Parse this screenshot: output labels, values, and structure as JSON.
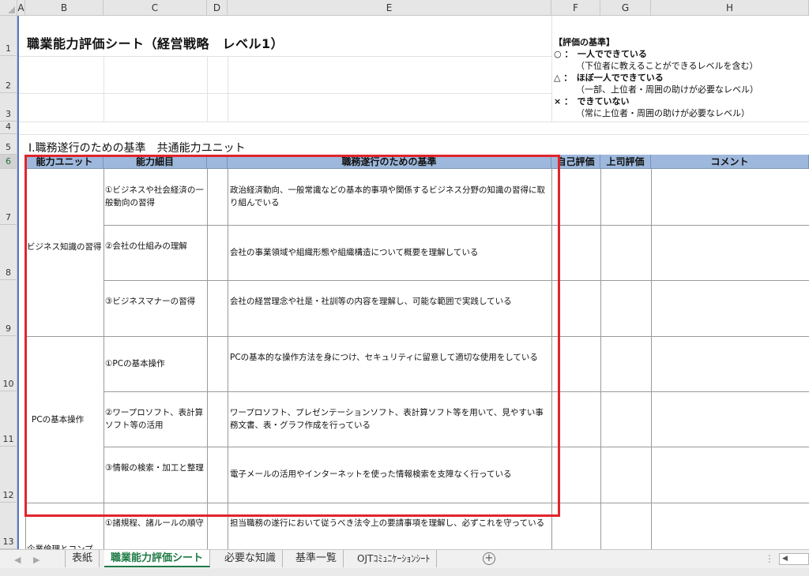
{
  "columns": [
    "A",
    "B",
    "C",
    "D",
    "E",
    "F",
    "G",
    "H"
  ],
  "rows": [
    "1",
    "2",
    "3",
    "4",
    "5",
    "6",
    "7",
    "8",
    "9",
    "10",
    "11",
    "12",
    "13"
  ],
  "title": "職業能力評価シート（経営戦略　レベル1）",
  "legend": {
    "heading": "【評価の基準】",
    "line1": "○ ：　一人でできている",
    "line1_note": "（下位者に教えることができるレベルを含む）",
    "line2": "△ ：　ほぼ一人でできている",
    "line2_note": "（一部、上位者・周囲の助けが必要なレベル）",
    "line3": "× ：　できていない",
    "line3_note": "（常に上位者・周囲の助けが必要なレベル）"
  },
  "section_title": "Ⅰ.職務遂行のための基準　共通能力ユニット",
  "table_headers": {
    "unit": "能力ユニット",
    "detail": "能力細目",
    "criteria": "職務遂行のための基準",
    "self_eval": "自己評価",
    "boss_eval": "上司評価",
    "comment": "コメント"
  },
  "units": {
    "u1": "ビジネス知識の習得",
    "u2": "PCの基本操作",
    "u3": "企業倫理とコンプ"
  },
  "items": [
    {
      "detail": "①ビジネスや社会経済の一般動向の習得",
      "criteria": "政治経済動向、一般常識などの基本的事項や関係するビジネス分野の知識の習得に取り組んでいる"
    },
    {
      "detail": "②会社の仕組みの理解",
      "criteria": "会社の事業領域や組織形態や組織構造について概要を理解している"
    },
    {
      "detail": "③ビジネスマナーの習得",
      "criteria": "会社の経営理念や社是・社訓等の内容を理解し、可能な範囲で実践している"
    },
    {
      "detail": "①PCの基本操作",
      "criteria": "PCの基本的な操作方法を身につけ、セキュリティに留意して適切な使用をしている"
    },
    {
      "detail": "②ワープロソフト、表計算ソフト等の活用",
      "criteria": "ワープロソフト、プレゼンテーションソフト、表計算ソフト等を用いて、見やすい事務文書、表・グラフ作成を行っている"
    },
    {
      "detail": "③情報の検索・加工と整理",
      "criteria": "電子メールの活用やインターネットを使った情報検索を支障なく行っている"
    },
    {
      "detail": "①諸規程、諸ルールの順守",
      "criteria": "担当職務の遂行において従うべき法令上の要請事項を理解し、必ずこれを守っている"
    }
  ],
  "sheet_tabs": [
    "表紙",
    "職業能力評価シート",
    "必要な知識",
    "基準一覧",
    "OJTｺﾐｭﾆｹｰｼｮﾝｼｰﾄ"
  ],
  "active_tab": "職業能力評価シート",
  "colors": {
    "header_band": "#9db8dc",
    "highlight_border": "#e0252b",
    "active_tab": "#1f7a45"
  }
}
